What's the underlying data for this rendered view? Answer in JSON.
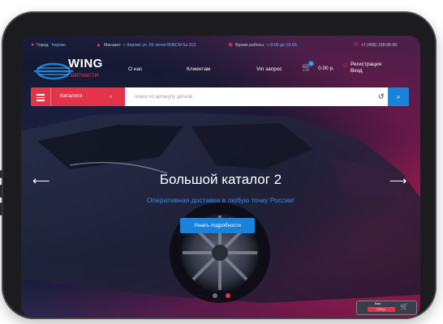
{
  "topbar": {
    "city_label": "Город:",
    "city_value": "Кирово",
    "shop_label": "Магазин:",
    "shop_value": "г. Кирово ул. 50 летия ВЛКСМ 5а 313",
    "hours_label": "Время работы:",
    "hours_value": "с 9-00 до 19-00",
    "phone": "+7 (495) 128-95-60"
  },
  "logo": {
    "title": "WING",
    "subtitle": "запчасти"
  },
  "nav": {
    "about": "О нас",
    "clients": "Клиентам",
    "vin": "Vin запрос"
  },
  "cart": {
    "count": "0",
    "sum": "0.00 р."
  },
  "auth": {
    "register": "Регистрация",
    "login": "Вход"
  },
  "search": {
    "catalog_label": "Каталоги",
    "placeholder": "поиск по артикулу детали"
  },
  "hero": {
    "title": "Большой каталог 2",
    "subtitle": "Оперативная доставка в любую точку России!",
    "button": "Узнать подробности",
    "active_slide": 2,
    "slide_count": 2
  },
  "minicart": {
    "label": "Ваш",
    "sum": "0.00 р."
  },
  "colors": {
    "accent_red": "#e2354b",
    "accent_blue": "#1a82d9"
  },
  "icons": {
    "location": "map-pin-icon",
    "shop": "store-icon",
    "clock": "clock-icon",
    "phone": "phone-icon",
    "cart": "cart-icon",
    "user": "user-icon",
    "menu": "menu-icon",
    "history": "history-icon",
    "search": "search-icon",
    "arrow_left": "arrow-left-icon",
    "arrow_right": "arrow-right-icon",
    "basket": "basket-icon"
  }
}
